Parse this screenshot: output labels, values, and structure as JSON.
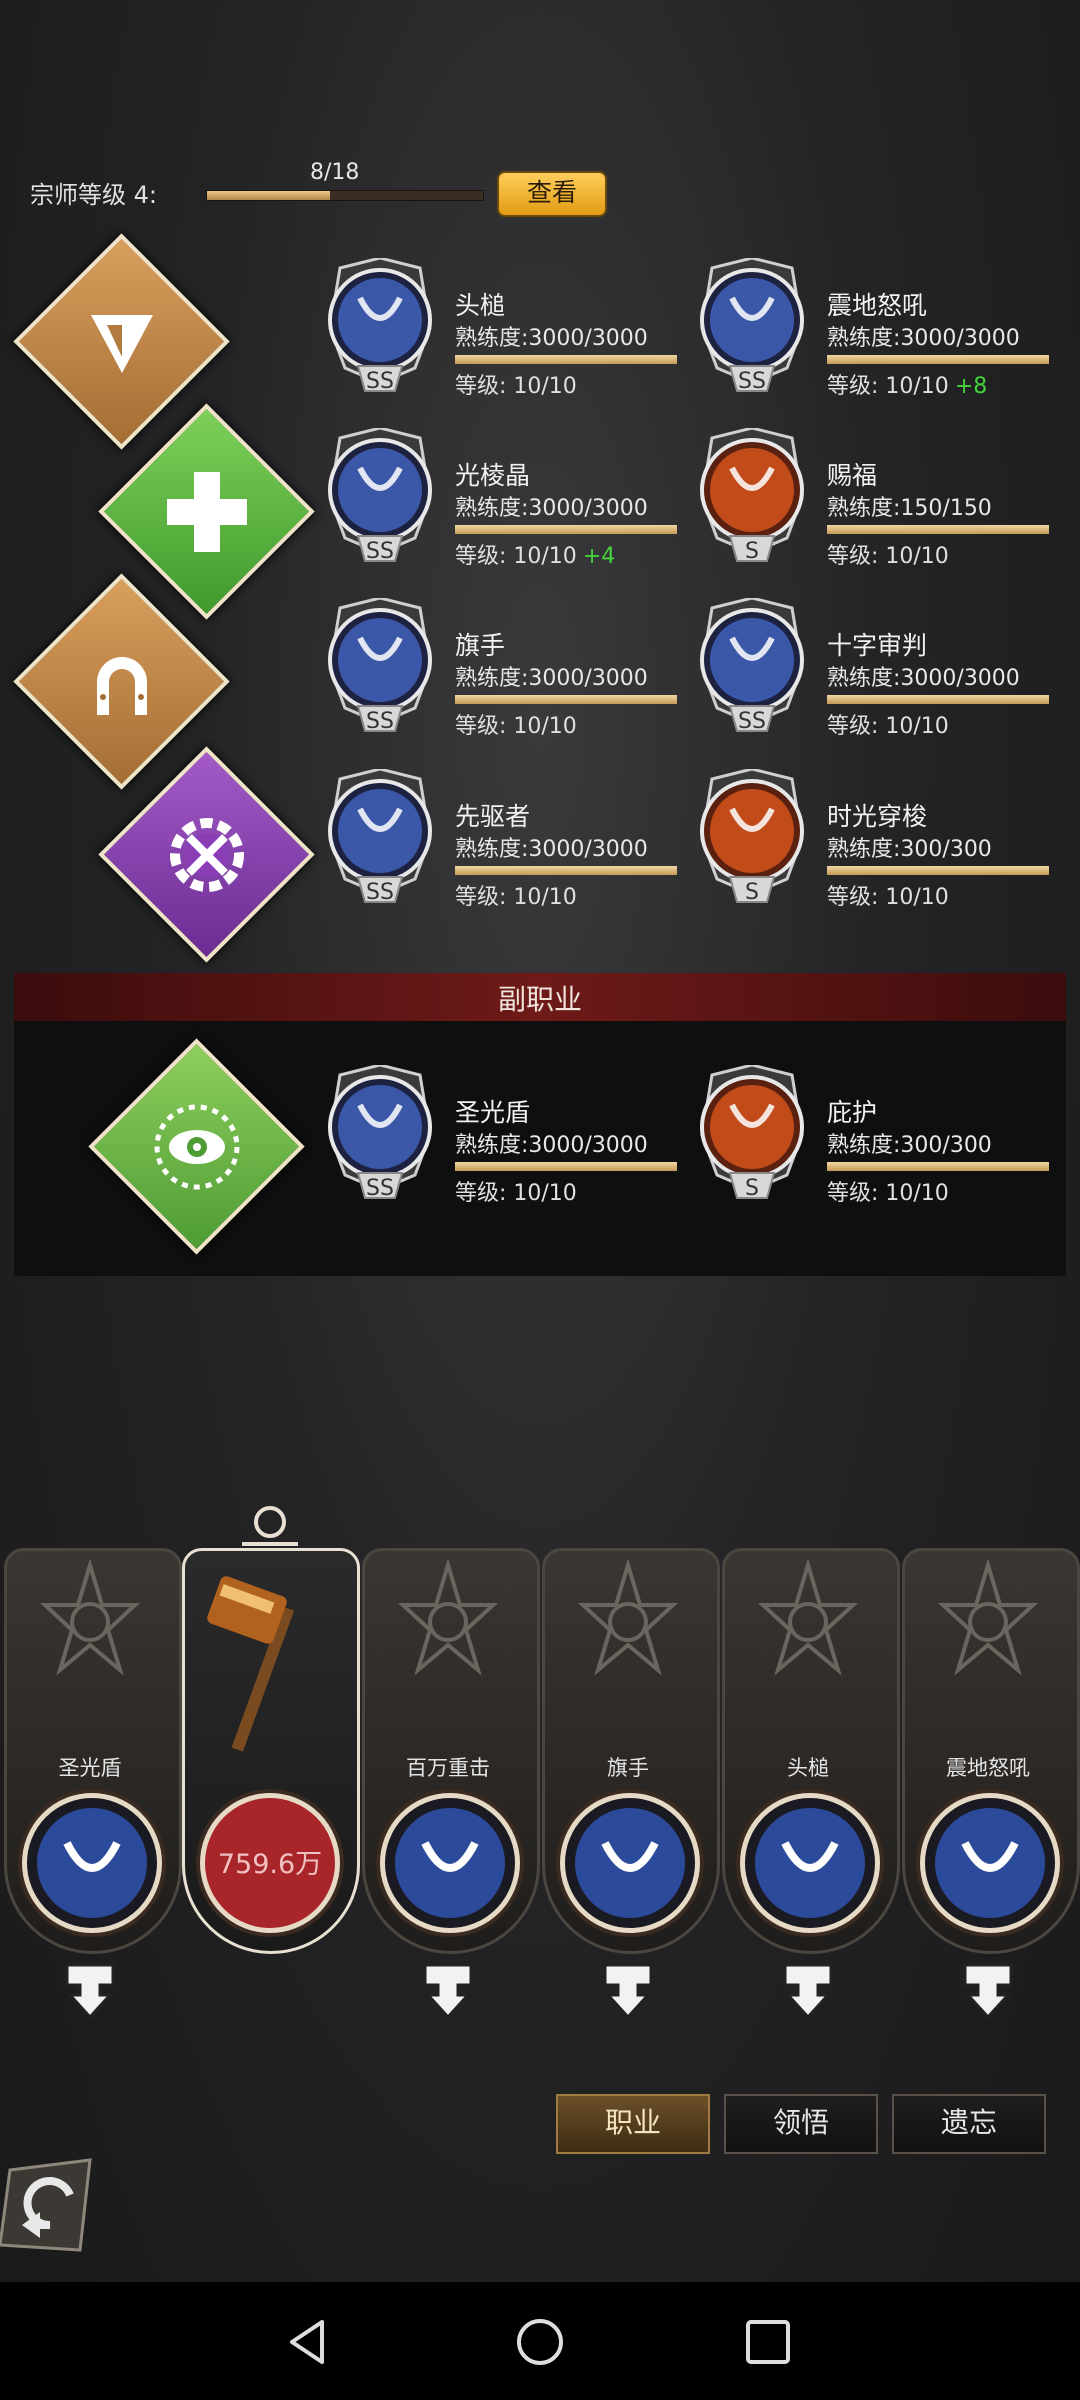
{
  "master": {
    "label": "宗师等级 4:",
    "count": "8/18",
    "progress": 0.444,
    "view_label": "查看"
  },
  "skills": [
    {
      "name": "头槌",
      "proficiency": "熟练度:3000/3000",
      "level": "等级: 10/10",
      "bonus": "",
      "grade": "SS"
    },
    {
      "name": "震地怒吼",
      "proficiency": "熟练度:3000/3000",
      "level": "等级: 10/10",
      "bonus": "+8",
      "grade": "SS"
    },
    {
      "name": "光棱晶",
      "proficiency": "熟练度:3000/3000",
      "level": "等级: 10/10",
      "bonus": "+4",
      "grade": "SS"
    },
    {
      "name": "赐福",
      "proficiency": "熟练度:150/150",
      "level": "等级: 10/10",
      "bonus": "",
      "grade": "S"
    },
    {
      "name": "旗手",
      "proficiency": "熟练度:3000/3000",
      "level": "等级: 10/10",
      "bonus": "",
      "grade": "SS"
    },
    {
      "name": "十字审判",
      "proficiency": "熟练度:3000/3000",
      "level": "等级: 10/10",
      "bonus": "",
      "grade": "SS"
    },
    {
      "name": "先驱者",
      "proficiency": "熟练度:3000/3000",
      "level": "等级: 10/10",
      "bonus": "",
      "grade": "SS"
    },
    {
      "name": "时光穿梭",
      "proficiency": "熟练度:300/300",
      "level": "等级: 10/10",
      "bonus": "",
      "grade": "S"
    }
  ],
  "sub_job": {
    "title": "副职业",
    "skills": [
      {
        "name": "圣光盾",
        "proficiency": "熟练度:3000/3000",
        "level": "等级: 10/10",
        "grade": "SS"
      },
      {
        "name": "庇护",
        "proficiency": "熟练度:300/300",
        "level": "等级: 10/10",
        "grade": "S"
      }
    ]
  },
  "cards": [
    {
      "name": "圣光盾"
    },
    {
      "name": "",
      "value": "759.6万"
    },
    {
      "name": "百万重击"
    },
    {
      "name": "旗手"
    },
    {
      "name": "头槌"
    },
    {
      "name": "震地怒吼"
    }
  ],
  "tabs": {
    "job": "职业",
    "insight": "领悟",
    "forget": "遗忘"
  },
  "colors": {
    "accent_gold": "#e29b15",
    "bonus_green": "#45d43e",
    "sub_header_red": "#6e1a18"
  }
}
